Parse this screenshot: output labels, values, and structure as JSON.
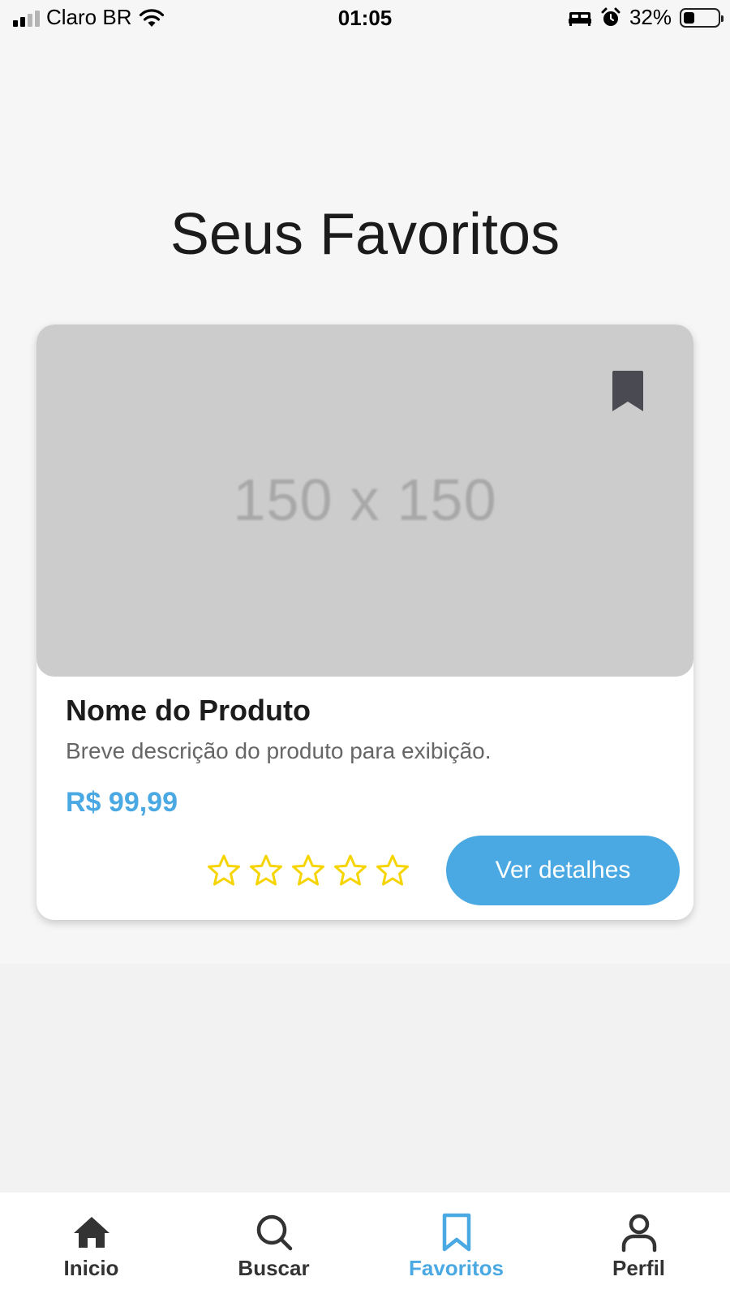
{
  "status_bar": {
    "carrier": "Claro BR",
    "time": "01:05",
    "battery_percent": "32%",
    "battery_level": 0.32,
    "signal_bars": 2,
    "icons": [
      "signal-icon",
      "wifi-icon",
      "bed-icon",
      "alarm-icon",
      "battery-icon"
    ]
  },
  "page": {
    "title": "Seus Favoritos"
  },
  "card": {
    "image_placeholder": "150 x 150",
    "name": "Nome do Produto",
    "description": "Breve descrição do produto para exibição.",
    "price": "R$ 99,99",
    "rating": 0,
    "rating_max": 5,
    "details_button": "Ver detalhes",
    "bookmark_icon": "bookmark-icon"
  },
  "tab_bar": {
    "tabs": [
      {
        "label": "Inicio",
        "icon": "home-icon",
        "active": false
      },
      {
        "label": "Buscar",
        "icon": "search-icon",
        "active": false
      },
      {
        "label": "Favoritos",
        "icon": "bookmark-icon",
        "active": true
      },
      {
        "label": "Perfil",
        "icon": "user-icon",
        "active": false
      }
    ]
  },
  "colors": {
    "accent": "#4aa8e3",
    "star": "#f5d400",
    "placeholder_bg": "#cccccc",
    "bookmark": "#4a4a52"
  }
}
